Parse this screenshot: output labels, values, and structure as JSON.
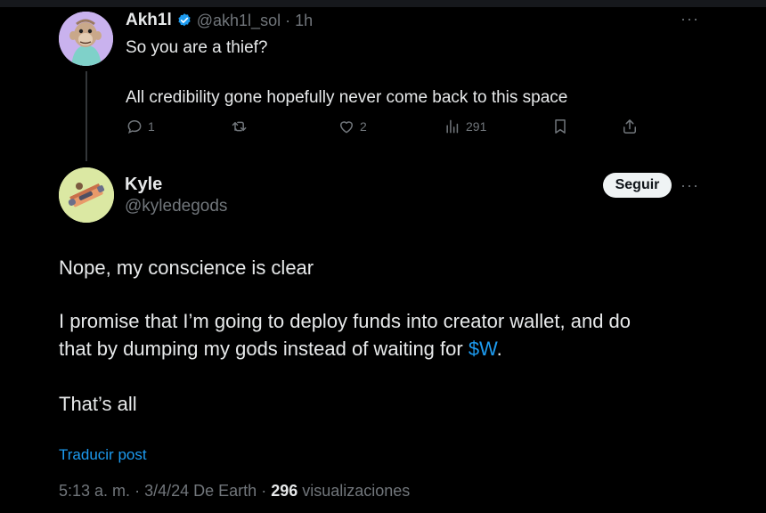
{
  "reply": {
    "name": "Akh1l",
    "handle": "@akh1l_sol",
    "separator": "·",
    "time": "1h",
    "more_icon": "more-dots-icon",
    "lines": [
      "So you are a thief?",
      "All credibility gone hopefully never come back to this space"
    ],
    "actions": {
      "reply_count": "1",
      "retweet_count": "",
      "like_count": "2",
      "views_count": "291"
    }
  },
  "main": {
    "name": "Kyle",
    "handle": "@kyledegods",
    "follow_label": "Seguir",
    "body": {
      "line1": "Nope, my conscience is clear",
      "line2": "I promise that I’m going to deploy funds into creator wallet, and do",
      "line3_pre": "that by dumping my gods instead of waiting for ",
      "line3_link": "$W",
      "line3_post": ".",
      "line4": "That’s all"
    },
    "translate_label": "Traducir post",
    "meta": {
      "time": "5:13 a. m.",
      "date": "3/4/24",
      "source": "De Earth",
      "views": "296",
      "views_label": "visualizaciones"
    }
  },
  "colors": {
    "background": "#000000",
    "text": "#e7e9ea",
    "muted": "#71767b",
    "link": "#1d9bf0",
    "verified": "#1d9bf0"
  }
}
